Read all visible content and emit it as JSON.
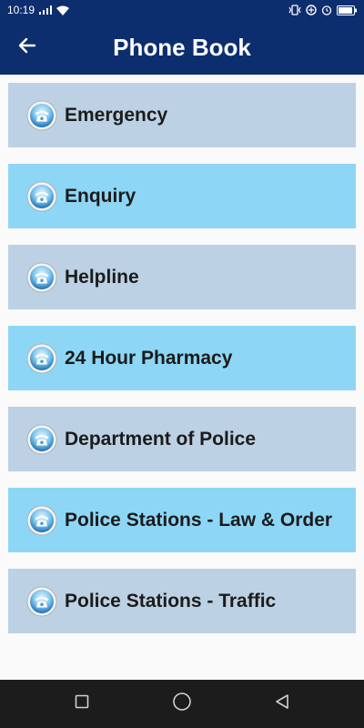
{
  "status_bar": {
    "time": "10:19",
    "icons": [
      "signal-icon",
      "wifi-icon",
      "vibrate-icon",
      "data-saver-icon",
      "alarm-icon",
      "battery-icon"
    ]
  },
  "app_bar": {
    "title": "Phone Book",
    "back_icon": "arrow-left-icon"
  },
  "items": [
    {
      "label": "Emergency",
      "style": "gray"
    },
    {
      "label": "Enquiry",
      "style": "blue"
    },
    {
      "label": "Helpline",
      "style": "gray"
    },
    {
      "label": "24 Hour Pharmacy",
      "style": "blue"
    },
    {
      "label": "Department of Police",
      "style": "gray"
    },
    {
      "label": "Police Stations - Law & Order",
      "style": "blue"
    },
    {
      "label": "Police Stations - Traffic",
      "style": "gray"
    }
  ],
  "colors": {
    "primary": "#0d2e6e",
    "item_gray": "#bcd1e3",
    "item_blue": "#8ed6f5"
  },
  "nav": [
    "recent-apps-icon",
    "home-icon",
    "back-icon"
  ]
}
